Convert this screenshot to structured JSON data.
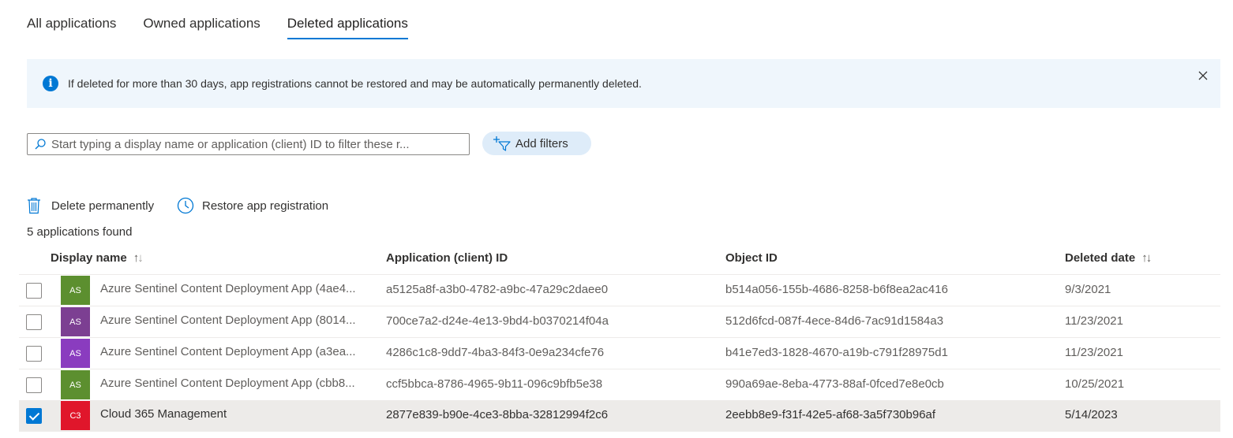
{
  "tabs": [
    {
      "label": "All applications",
      "active": false
    },
    {
      "label": "Owned applications",
      "active": false
    },
    {
      "label": "Deleted applications",
      "active": true
    }
  ],
  "banner": {
    "icon": "info-icon",
    "message": "If deleted for more than 30 days, app registrations cannot be restored and may be automatically permanently deleted.",
    "close_icon": "close-icon"
  },
  "search": {
    "placeholder": "Start typing a display name or application (client) ID to filter these r...",
    "value": ""
  },
  "filters": {
    "add_label": "Add filters"
  },
  "commands": {
    "delete_label": "Delete permanently",
    "restore_label": "Restore app registration"
  },
  "result_count": "5 applications found",
  "columns": {
    "display_name": "Display name",
    "app_id": "Application (client) ID",
    "object_id": "Object ID",
    "deleted_date": "Deleted date"
  },
  "rows": [
    {
      "initials": "AS",
      "color": "#5c8f2f",
      "name": "Azure Sentinel Content Deployment App (4ae4...",
      "app_id": "a5125a8f-a3b0-4782-a9bc-47a29c2daee0",
      "object_id": "b514a056-155b-4686-8258-b6f8ea2ac416",
      "deleted_date": "9/3/2021",
      "selected": false
    },
    {
      "initials": "AS",
      "color": "#7c3f92",
      "name": "Azure Sentinel Content Deployment App (8014...",
      "app_id": "700ce7a2-d24e-4e13-9bd4-b0370214f04a",
      "object_id": "512d6fcd-087f-4ece-84d6-7ac91d1584a3",
      "deleted_date": "11/23/2021",
      "selected": false
    },
    {
      "initials": "AS",
      "color": "#8a3cbf",
      "name": "Azure Sentinel Content Deployment App (a3ea...",
      "app_id": "4286c1c8-9dd7-4ba3-84f3-0e9a234cfe76",
      "object_id": "b41e7ed3-1828-4670-a19b-c791f28975d1",
      "deleted_date": "11/23/2021",
      "selected": false
    },
    {
      "initials": "AS",
      "color": "#5c8f2f",
      "name": "Azure Sentinel Content Deployment App (cbb8...",
      "app_id": "ccf5bbca-8786-4965-9b11-096c9bfb5e38",
      "object_id": "990a69ae-8eba-4773-88af-0fced7e8e0cb",
      "deleted_date": "10/25/2021",
      "selected": false
    },
    {
      "initials": "C3",
      "color": "#e0162b",
      "name": "Cloud 365 Management",
      "app_id": "2877e839-b90e-4ce3-8bba-32812994f2c6",
      "object_id": "2eebb8e9-f31f-42e5-af68-3a5f730b96af",
      "deleted_date": "5/14/2023",
      "selected": true
    }
  ]
}
